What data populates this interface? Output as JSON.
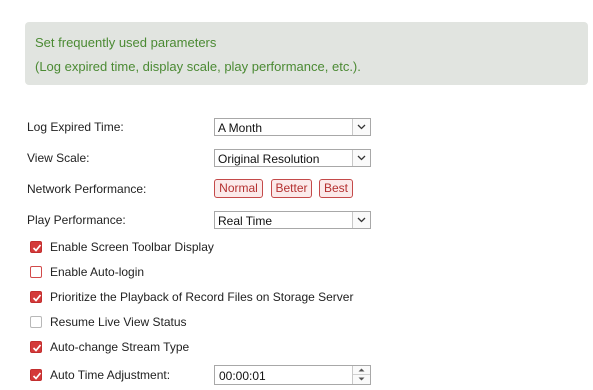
{
  "info": {
    "line1": "Set frequently used parameters",
    "line2": "(Log expired time, display scale, play performance, etc.)."
  },
  "log_expired": {
    "label": "Log Expired Time:",
    "value": "A Month"
  },
  "view_scale": {
    "label": "View Scale:",
    "value": "Original Resolution"
  },
  "network": {
    "label": "Network Performance:",
    "options": [
      "Normal",
      "Better",
      "Best"
    ]
  },
  "play": {
    "label": "Play Performance:",
    "value": "Real Time"
  },
  "checkboxes": [
    {
      "label": "Enable Screen Toolbar Display",
      "checked": true
    },
    {
      "label": "Enable Auto-login",
      "checked": false
    },
    {
      "label": "Prioritize the Playback of Record Files on Storage Server",
      "checked": true
    },
    {
      "label": "Resume Live View Status",
      "checked": false
    },
    {
      "label": "Auto-change Stream Type",
      "checked": true
    },
    {
      "label": "Auto Time Adjustment:",
      "checked": true
    }
  ],
  "auto_time": {
    "value": "00:00:01"
  },
  "colors": {
    "accent": "#d43a3a",
    "info_text": "#4b8a33",
    "info_bg": "#e1e4e0"
  }
}
